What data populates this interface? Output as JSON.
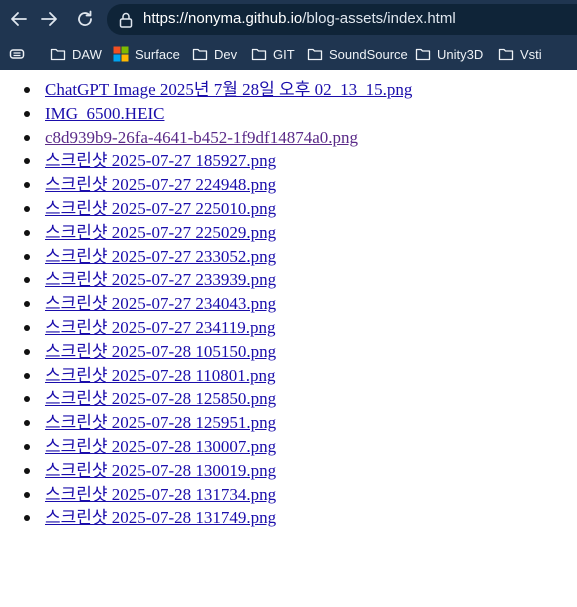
{
  "browser": {
    "url_host": "https://nonyma.github.io",
    "url_path": "/blog-assets/index.html"
  },
  "bookmarks": [
    {
      "label": "DAW",
      "icon": "folder-icon"
    },
    {
      "label": "Surface",
      "icon": "microsoft-logo-icon"
    },
    {
      "label": "Dev",
      "icon": "folder-icon"
    },
    {
      "label": "GIT",
      "icon": "folder-icon"
    },
    {
      "label": "SoundSource",
      "icon": "folder-icon"
    },
    {
      "label": "Unity3D",
      "icon": "folder-icon"
    },
    {
      "label": "Vsti",
      "icon": "folder-icon"
    }
  ],
  "files": [
    "ChatGPT Image 2025년 7월 28일 오후 02_13_15.png",
    "IMG_6500.HEIC",
    "c8d939b9-26fa-4641-b452-1f9df14874a0.png",
    "스크린샷 2025-07-27 185927.png",
    "스크린샷 2025-07-27 224948.png",
    "스크린샷 2025-07-27 225010.png",
    "스크린샷 2025-07-27 225029.png",
    "스크린샷 2025-07-27 233052.png",
    "스크린샷 2025-07-27 233939.png",
    "스크린샷 2025-07-27 234043.png",
    "스크린샷 2025-07-27 234119.png",
    "스크린샷 2025-07-28 105150.png",
    "스크린샷 2025-07-28 110801.png",
    "스크린샷 2025-07-28 125850.png",
    "스크린샷 2025-07-28 125951.png",
    "스크린샷 2025-07-28 130007.png",
    "스크린샷 2025-07-28 130019.png",
    "스크린샷 2025-07-28 131734.png",
    "스크린샷 2025-07-28 131749.png"
  ],
  "colors": {
    "toolbar_bg": "#1f3550",
    "link": "#1a0dab",
    "visited_link": "#5a2a88"
  }
}
